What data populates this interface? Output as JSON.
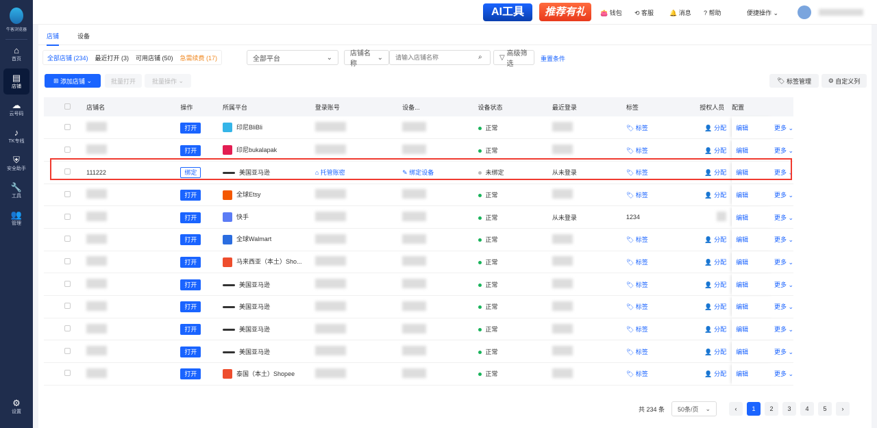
{
  "sidebar": {
    "brand": "牛客浏览器",
    "items": [
      {
        "icon": "home",
        "label": "首页"
      },
      {
        "icon": "store",
        "label": "店铺"
      },
      {
        "icon": "cloud",
        "label": "云号码"
      },
      {
        "icon": "tiktok",
        "label": "TK专线"
      },
      {
        "icon": "shield",
        "label": "安全助手"
      },
      {
        "icon": "wrench",
        "label": "工具"
      },
      {
        "icon": "users",
        "label": "管理"
      }
    ],
    "settings": "设置"
  },
  "topbar": {
    "ai": "AI工具",
    "referral": "推荐有礼",
    "wallet": "钱包",
    "service": "客服",
    "message": "消息",
    "help": "帮助",
    "quick": "便捷操作"
  },
  "tabs": [
    "店铺",
    "设备"
  ],
  "filters": {
    "all": "全部店铺 (234)",
    "recent": "最近打开 (3)",
    "available": "可用店铺 (50)",
    "expiring": "急需续费 (17)",
    "platform": "全部平台",
    "search_field": "店铺名称",
    "search_placeholder": "请输入店铺名称",
    "advanced": "高级筛选",
    "reset": "重置条件"
  },
  "toolbar": {
    "add": "添加店铺",
    "batch_open": "批量打开",
    "batch_ops": "批量操作",
    "tag_manage": "标签管理",
    "custom_cols": "自定义列"
  },
  "columns": [
    "店铺名",
    "操作",
    "所属平台",
    "登录账号",
    "设备...",
    "设备状态",
    "最近登录",
    "标签",
    "授权人员",
    "配置"
  ],
  "actions": {
    "open": "打开",
    "bind": "绑定",
    "tag": "标签",
    "assign": "分配",
    "edit": "编辑",
    "more": "更多",
    "host": "托管账密",
    "bind_device": "绑定设备"
  },
  "rows": [
    {
      "name": "",
      "platform": "印尼BliBli",
      "status": "正常",
      "login": ""
    },
    {
      "name": "",
      "platform": "印尼bukalapak",
      "status": "正常",
      "login": ""
    },
    {
      "name": "111222",
      "platform": "美国亚马逊",
      "status": "未绑定",
      "login": "从未登录",
      "unbound": true
    },
    {
      "name": "",
      "platform": "全球Etsy",
      "status": "正常",
      "login": ""
    },
    {
      "name": "",
      "platform": "快手",
      "status": "正常",
      "login": "从未登录",
      "tag": "1234"
    },
    {
      "name": "",
      "platform": "全球Walmart",
      "status": "正常",
      "login": ""
    },
    {
      "name": "",
      "platform": "马来西亚（本土）Sho...",
      "status": "正常",
      "login": ""
    },
    {
      "name": "",
      "platform": "美国亚马逊",
      "status": "正常",
      "login": ""
    },
    {
      "name": "",
      "platform": "美国亚马逊",
      "status": "正常",
      "login": ""
    },
    {
      "name": "",
      "platform": "美国亚马逊",
      "status": "正常",
      "login": ""
    },
    {
      "name": "",
      "platform": "美国亚马逊",
      "status": "正常",
      "login": ""
    },
    {
      "name": "",
      "platform": "泰国（本土）Shopee",
      "status": "正常",
      "login": ""
    }
  ],
  "pagination": {
    "total": "共 234 条",
    "size": "50条/页",
    "pages": [
      "1",
      "2",
      "3",
      "4",
      "5"
    ],
    "current": "1"
  }
}
